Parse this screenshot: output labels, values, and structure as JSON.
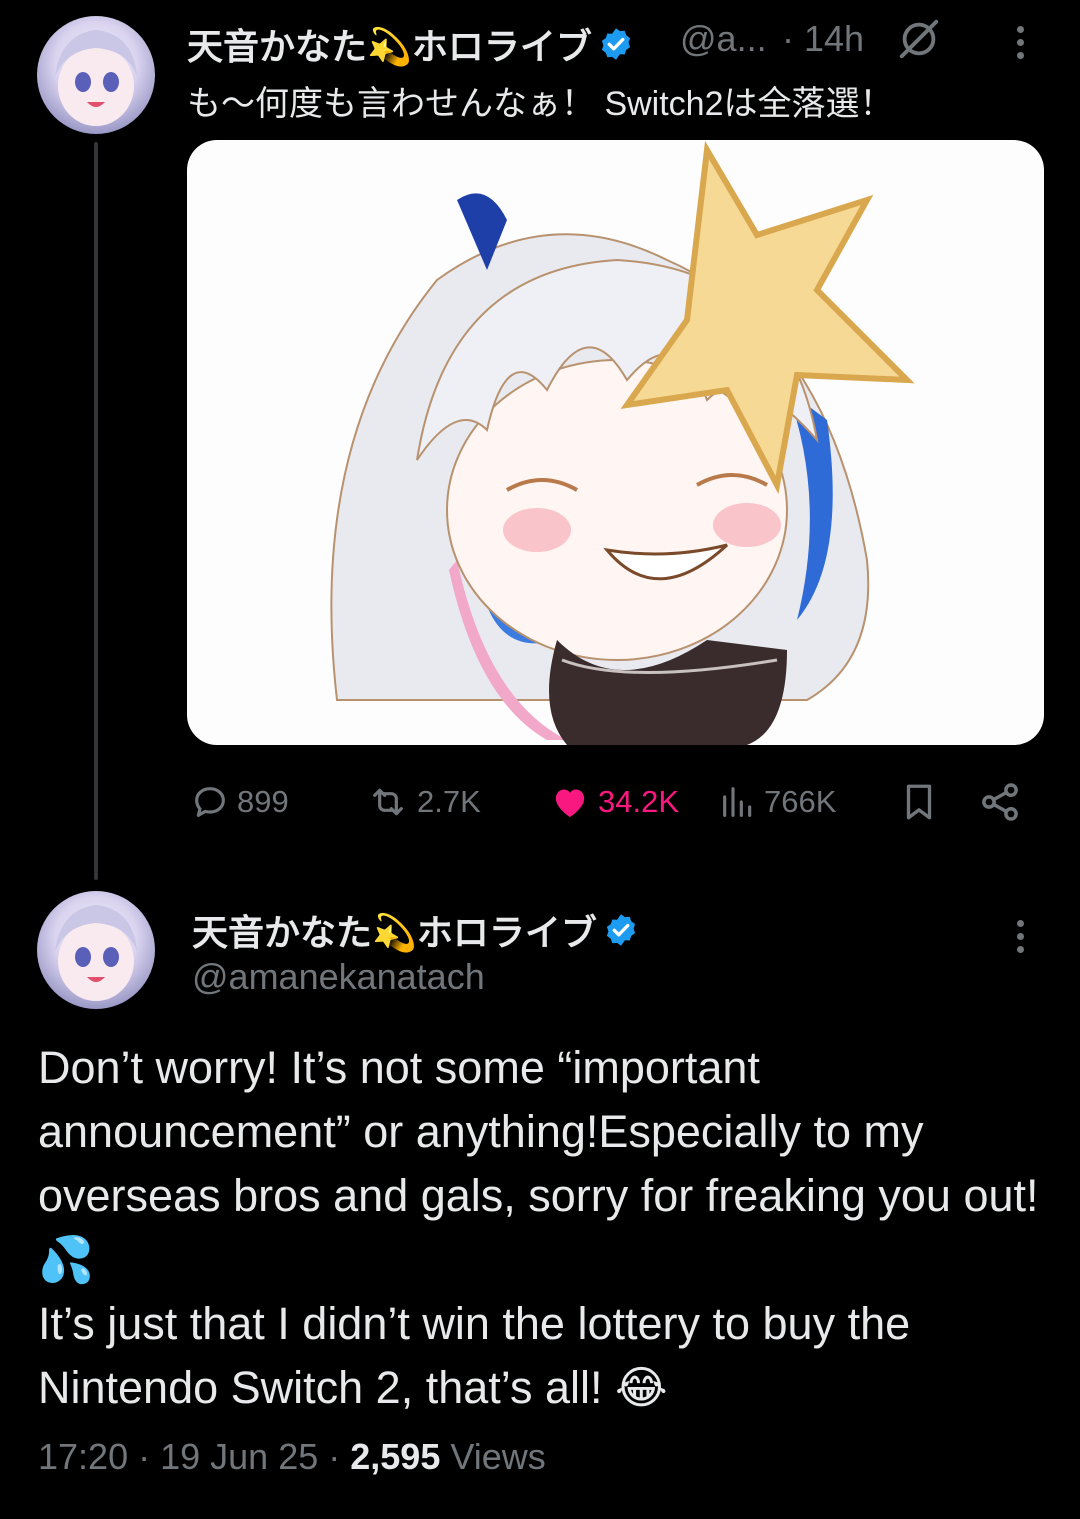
{
  "parent_tweet": {
    "author_name": "天音かなた💫ホロライブ",
    "handle": "@a...",
    "separator": "·",
    "time": "14h",
    "text": "も〜何度も言わせんなぁ！ Switch2は全落選！",
    "actions": {
      "replies": "899",
      "reposts": "2.7K",
      "likes": "34.2K",
      "views": "766K"
    }
  },
  "main_tweet": {
    "author_name": "天音かなた💫ホロライブ",
    "handle": "@amanekanatach",
    "text_lines": [
      "Don’t worry! It’s not some “important announcement” or anything!Especially to my overseas bros and gals, sorry for freaking you out! 💦",
      "It’s just that I didn’t win the lottery to buy the Nintendo Switch 2, that’s all! 😂"
    ],
    "time": "17:20",
    "date": "19 Jun 25",
    "views_count": "2,595",
    "views_label": "Views"
  },
  "colors": {
    "background": "#000000",
    "text": "#e7e9ea",
    "muted": "#71767b",
    "verified": "#1d9bf0",
    "like": "#f91880"
  },
  "icons": [
    "verified-badge-icon",
    "grok-slash-icon",
    "more-dots-icon",
    "reply-icon",
    "repost-icon",
    "like-heart-icon",
    "views-bar-icon",
    "bookmark-icon",
    "share-icon"
  ]
}
